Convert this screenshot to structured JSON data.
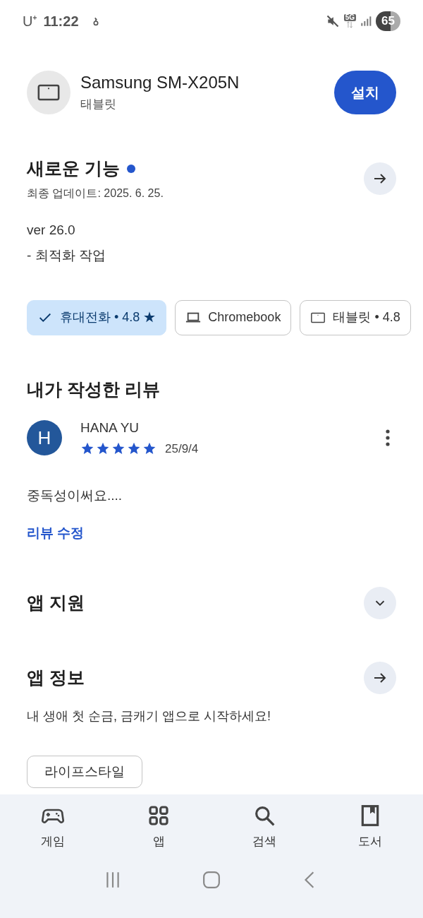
{
  "status_bar": {
    "carrier": "U⁺",
    "time": "11:22",
    "network": "5G",
    "battery": "65"
  },
  "device": {
    "name": "Samsung SM-X205N",
    "type": "태블릿",
    "install": "설치"
  },
  "whats_new": {
    "title": "새로운 기능",
    "new_dot": true,
    "updated": "최종 업데이트: 2025. 6. 25.",
    "version": "ver 26.0",
    "notes": "- 최적화 작업"
  },
  "device_chips": [
    {
      "kind": "phone",
      "label": "휴대전화 • 4.8 ★",
      "selected": true
    },
    {
      "kind": "laptop",
      "label": "Chromebook",
      "selected": false
    },
    {
      "kind": "tablet",
      "label": "태블릿 • 4.8",
      "selected": false
    }
  ],
  "my_review": {
    "title": "내가 작성한 리뷰",
    "avatar": "H",
    "author": "HANA YU",
    "stars": 5,
    "date": "25/9/4",
    "text": "중독성이써요....",
    "edit": "리뷰 수정"
  },
  "app_support": {
    "title": "앱 지원",
    "expanded": false
  },
  "app_info": {
    "title": "앱 정보",
    "description": "내 생애 첫 순금, 금캐기 앱으로 시작하세요!",
    "tag": "라이프스타일"
  },
  "bottom_nav": [
    {
      "kind": "games",
      "label": "게임",
      "selected": false
    },
    {
      "kind": "apps",
      "label": "앱",
      "selected": false
    },
    {
      "kind": "search",
      "label": "검색",
      "selected": false
    },
    {
      "kind": "books",
      "label": "도서",
      "selected": false
    }
  ]
}
